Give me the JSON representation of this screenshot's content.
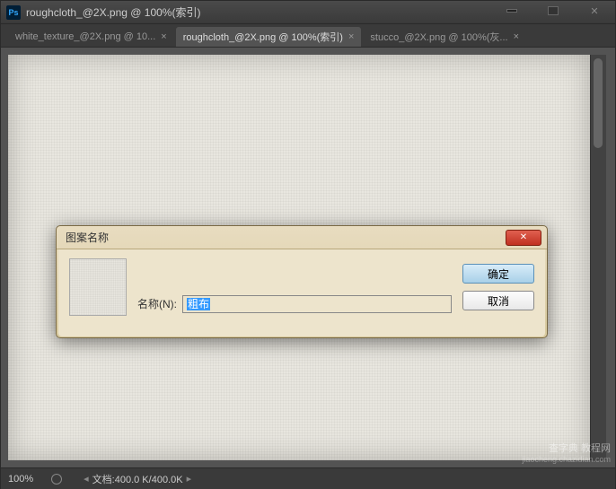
{
  "window": {
    "ps_label": "Ps",
    "title": "roughcloth_@2X.png @ 100%(索引)"
  },
  "tabs": [
    {
      "label": "white_texture_@2X.png @ 10...",
      "active": false
    },
    {
      "label": "roughcloth_@2X.png @ 100%(索引)",
      "active": true
    },
    {
      "label": "stucco_@2X.png @ 100%(灰...",
      "active": false
    }
  ],
  "status": {
    "zoom": "100%",
    "doc_label": "文档:400.0 K/400.0K"
  },
  "dialog": {
    "title": "图案名称",
    "name_label": "名称(N):",
    "name_value": "粗布",
    "ok_label": "确定",
    "cancel_label": "取消"
  },
  "watermark": {
    "main": "查字典 教程网",
    "sub": "jiaocheng.chazidian.com"
  }
}
